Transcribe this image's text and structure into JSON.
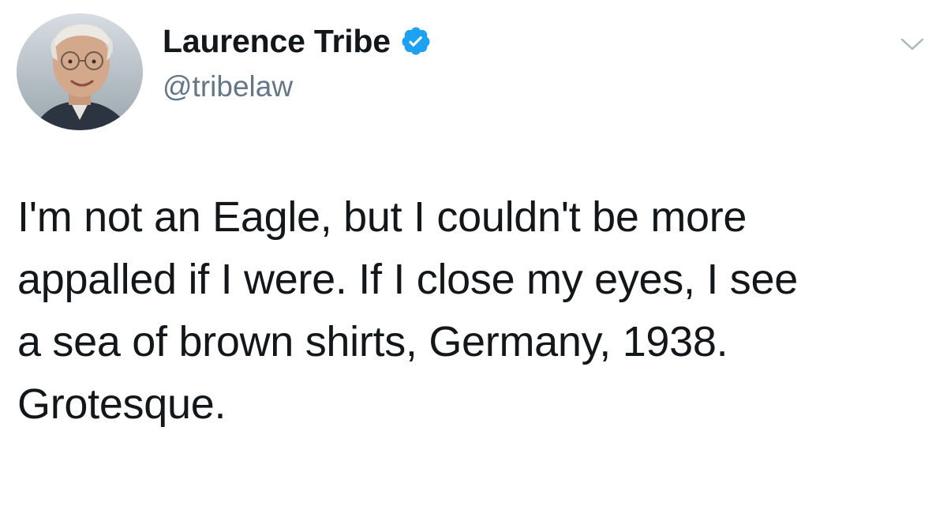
{
  "tweet": {
    "author": {
      "display_name": "Laurence Tribe",
      "handle": "@tribelaw",
      "verified": true,
      "avatar_icon": "profile-photo",
      "verified_icon": "verified-badge-icon"
    },
    "menu_icon": "chevron-down-icon",
    "text": "I'm not an Eagle, but I couldn't be more\nappalled if I were. If I close my eyes, I see\na sea of brown shirts, Germany, 1938.\nGrotesque.",
    "colors": {
      "verified_blue": "#1da1f2",
      "handle_gray": "#657786",
      "text": "#14171a",
      "caret_gray": "#aab8c2"
    }
  }
}
